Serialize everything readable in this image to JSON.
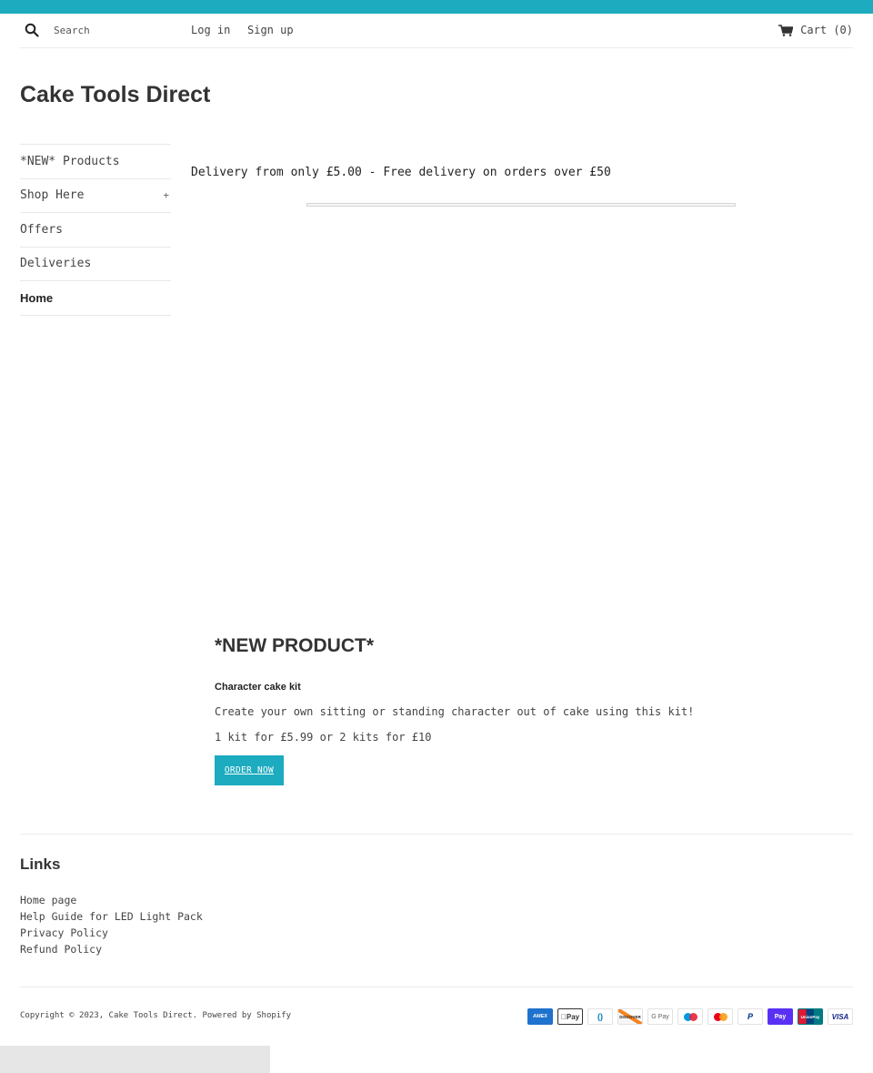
{
  "colors": {
    "accent": "#1cabbf",
    "text": "#333333",
    "border": "#e8e8e8"
  },
  "header": {
    "search_placeholder": "Search",
    "search_icon": "search-icon",
    "login_label": "Log in",
    "signup_label": "Sign up",
    "cart_icon": "cart-icon",
    "cart_label": "Cart (0)"
  },
  "site": {
    "title": "Cake Tools Direct"
  },
  "sidebar": {
    "items": [
      {
        "label": "*NEW* Products",
        "expandable": false,
        "active": false
      },
      {
        "label": "Shop Here",
        "expandable": true,
        "expand_icon": "+",
        "active": false
      },
      {
        "label": "Offers",
        "expandable": false,
        "active": false
      },
      {
        "label": "Deliveries",
        "expandable": false,
        "active": false
      },
      {
        "label": "Home",
        "expandable": false,
        "active": true
      }
    ]
  },
  "main": {
    "announcement": "Delivery from only £5.00 - Free delivery on orders over £50",
    "featured": {
      "title": "*NEW PRODUCT*",
      "product_name": "Character cake kit",
      "description": "Create your own sitting or standing character out of cake using this kit!",
      "price_text": "1 kit for £5.99 or 2 kits for £10",
      "button_label": "ORDER NOW"
    }
  },
  "footer": {
    "links_title": "Links",
    "links": [
      "Home page",
      "Help Guide for LED Light Pack",
      "Privacy Policy",
      "Refund Policy"
    ],
    "copyright_prefix": "Copyright © 2023, ",
    "copyright_store": "Cake Tools Direct",
    "copyright_powered": ". Powered by Shopify",
    "payment_methods": [
      {
        "name": "American Express",
        "label": "AMEX"
      },
      {
        "name": "Apple Pay",
        "label": "Pay"
      },
      {
        "name": "Diners Club",
        "label": "()"
      },
      {
        "name": "Discover",
        "label": "DISCOVER"
      },
      {
        "name": "Google Pay",
        "label": "G Pay"
      },
      {
        "name": "Maestro",
        "label": ""
      },
      {
        "name": "Mastercard",
        "label": ""
      },
      {
        "name": "PayPal",
        "label": "P"
      },
      {
        "name": "Shop Pay",
        "label": "Pay"
      },
      {
        "name": "Union Pay",
        "label": "UnionPay"
      },
      {
        "name": "Visa",
        "label": "VISA"
      }
    ]
  }
}
